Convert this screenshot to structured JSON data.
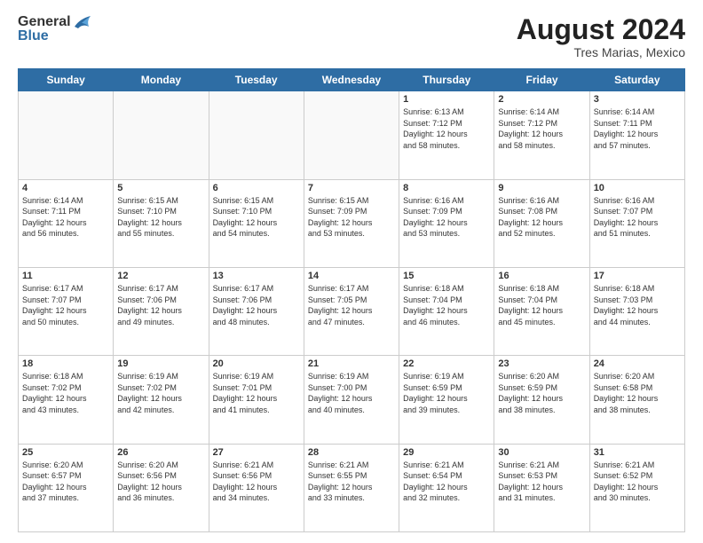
{
  "header": {
    "logo_general": "General",
    "logo_blue": "Blue",
    "title": "August 2024",
    "location": "Tres Marias, Mexico"
  },
  "days_of_week": [
    "Sunday",
    "Monday",
    "Tuesday",
    "Wednesday",
    "Thursday",
    "Friday",
    "Saturday"
  ],
  "weeks": [
    [
      {
        "day": "",
        "info": ""
      },
      {
        "day": "",
        "info": ""
      },
      {
        "day": "",
        "info": ""
      },
      {
        "day": "",
        "info": ""
      },
      {
        "day": "1",
        "info": "Sunrise: 6:13 AM\nSunset: 7:12 PM\nDaylight: 12 hours\nand 58 minutes."
      },
      {
        "day": "2",
        "info": "Sunrise: 6:14 AM\nSunset: 7:12 PM\nDaylight: 12 hours\nand 58 minutes."
      },
      {
        "day": "3",
        "info": "Sunrise: 6:14 AM\nSunset: 7:11 PM\nDaylight: 12 hours\nand 57 minutes."
      }
    ],
    [
      {
        "day": "4",
        "info": "Sunrise: 6:14 AM\nSunset: 7:11 PM\nDaylight: 12 hours\nand 56 minutes."
      },
      {
        "day": "5",
        "info": "Sunrise: 6:15 AM\nSunset: 7:10 PM\nDaylight: 12 hours\nand 55 minutes."
      },
      {
        "day": "6",
        "info": "Sunrise: 6:15 AM\nSunset: 7:10 PM\nDaylight: 12 hours\nand 54 minutes."
      },
      {
        "day": "7",
        "info": "Sunrise: 6:15 AM\nSunset: 7:09 PM\nDaylight: 12 hours\nand 53 minutes."
      },
      {
        "day": "8",
        "info": "Sunrise: 6:16 AM\nSunset: 7:09 PM\nDaylight: 12 hours\nand 53 minutes."
      },
      {
        "day": "9",
        "info": "Sunrise: 6:16 AM\nSunset: 7:08 PM\nDaylight: 12 hours\nand 52 minutes."
      },
      {
        "day": "10",
        "info": "Sunrise: 6:16 AM\nSunset: 7:07 PM\nDaylight: 12 hours\nand 51 minutes."
      }
    ],
    [
      {
        "day": "11",
        "info": "Sunrise: 6:17 AM\nSunset: 7:07 PM\nDaylight: 12 hours\nand 50 minutes."
      },
      {
        "day": "12",
        "info": "Sunrise: 6:17 AM\nSunset: 7:06 PM\nDaylight: 12 hours\nand 49 minutes."
      },
      {
        "day": "13",
        "info": "Sunrise: 6:17 AM\nSunset: 7:06 PM\nDaylight: 12 hours\nand 48 minutes."
      },
      {
        "day": "14",
        "info": "Sunrise: 6:17 AM\nSunset: 7:05 PM\nDaylight: 12 hours\nand 47 minutes."
      },
      {
        "day": "15",
        "info": "Sunrise: 6:18 AM\nSunset: 7:04 PM\nDaylight: 12 hours\nand 46 minutes."
      },
      {
        "day": "16",
        "info": "Sunrise: 6:18 AM\nSunset: 7:04 PM\nDaylight: 12 hours\nand 45 minutes."
      },
      {
        "day": "17",
        "info": "Sunrise: 6:18 AM\nSunset: 7:03 PM\nDaylight: 12 hours\nand 44 minutes."
      }
    ],
    [
      {
        "day": "18",
        "info": "Sunrise: 6:18 AM\nSunset: 7:02 PM\nDaylight: 12 hours\nand 43 minutes."
      },
      {
        "day": "19",
        "info": "Sunrise: 6:19 AM\nSunset: 7:02 PM\nDaylight: 12 hours\nand 42 minutes."
      },
      {
        "day": "20",
        "info": "Sunrise: 6:19 AM\nSunset: 7:01 PM\nDaylight: 12 hours\nand 41 minutes."
      },
      {
        "day": "21",
        "info": "Sunrise: 6:19 AM\nSunset: 7:00 PM\nDaylight: 12 hours\nand 40 minutes."
      },
      {
        "day": "22",
        "info": "Sunrise: 6:19 AM\nSunset: 6:59 PM\nDaylight: 12 hours\nand 39 minutes."
      },
      {
        "day": "23",
        "info": "Sunrise: 6:20 AM\nSunset: 6:59 PM\nDaylight: 12 hours\nand 38 minutes."
      },
      {
        "day": "24",
        "info": "Sunrise: 6:20 AM\nSunset: 6:58 PM\nDaylight: 12 hours\nand 38 minutes."
      }
    ],
    [
      {
        "day": "25",
        "info": "Sunrise: 6:20 AM\nSunset: 6:57 PM\nDaylight: 12 hours\nand 37 minutes."
      },
      {
        "day": "26",
        "info": "Sunrise: 6:20 AM\nSunset: 6:56 PM\nDaylight: 12 hours\nand 36 minutes."
      },
      {
        "day": "27",
        "info": "Sunrise: 6:21 AM\nSunset: 6:56 PM\nDaylight: 12 hours\nand 34 minutes."
      },
      {
        "day": "28",
        "info": "Sunrise: 6:21 AM\nSunset: 6:55 PM\nDaylight: 12 hours\nand 33 minutes."
      },
      {
        "day": "29",
        "info": "Sunrise: 6:21 AM\nSunset: 6:54 PM\nDaylight: 12 hours\nand 32 minutes."
      },
      {
        "day": "30",
        "info": "Sunrise: 6:21 AM\nSunset: 6:53 PM\nDaylight: 12 hours\nand 31 minutes."
      },
      {
        "day": "31",
        "info": "Sunrise: 6:21 AM\nSunset: 6:52 PM\nDaylight: 12 hours\nand 30 minutes."
      }
    ]
  ]
}
